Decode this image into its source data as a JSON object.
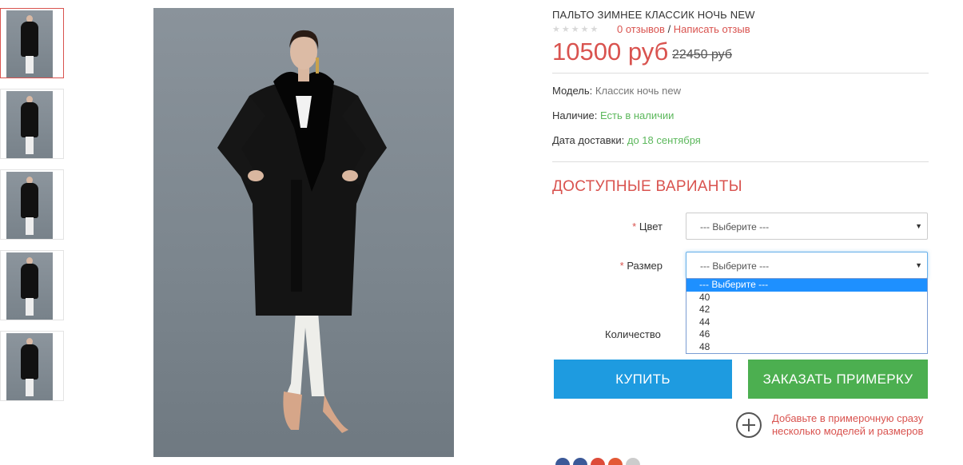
{
  "product": {
    "title": "ПАЛЬТО ЗИМНЕЕ КЛАССИК НОЧЬ NEW",
    "rating_stars": "★★★★★",
    "reviews_link": "0 отзывов",
    "reviews_separator": " / ",
    "write_review_link": "Написать отзыв",
    "price": "10500 руб",
    "old_price": "22450 руб"
  },
  "meta": {
    "model_label": "Модель:",
    "model_value": "Классик ночь new",
    "stock_label": "Наличие:",
    "stock_value": "Есть в наличии",
    "delivery_label": "Дата доставки:",
    "delivery_value": "до 18 сентября"
  },
  "options": {
    "title": "ДОСТУПНЫЕ ВАРИАНТЫ",
    "required_mark": "*",
    "color_label": "Цвет",
    "color_selected": "--- Выберите ---",
    "size_label": "Размер",
    "size_selected": "--- Выберите ---",
    "size_options": [
      "--- Выберите ---",
      "40",
      "42",
      "44",
      "46",
      "48"
    ],
    "quantity_label": "Количество"
  },
  "actions": {
    "buy_label": "КУПИТЬ",
    "try_on_label": "ЗАКАЗАТЬ ПРИМЕРКУ",
    "add_note": "Добавьте в примерочную сразу несколько моделей и размеров"
  },
  "colors": {
    "accent_red": "#d9534f",
    "buy_blue": "#1e9be0",
    "try_green": "#4caf50",
    "in_stock_green": "#5cb85c",
    "dropdown_highlight": "#1e90ff"
  },
  "icons": {
    "dropdown_arrow": "▼",
    "add_to_fitting": "plus-circle-icon"
  }
}
